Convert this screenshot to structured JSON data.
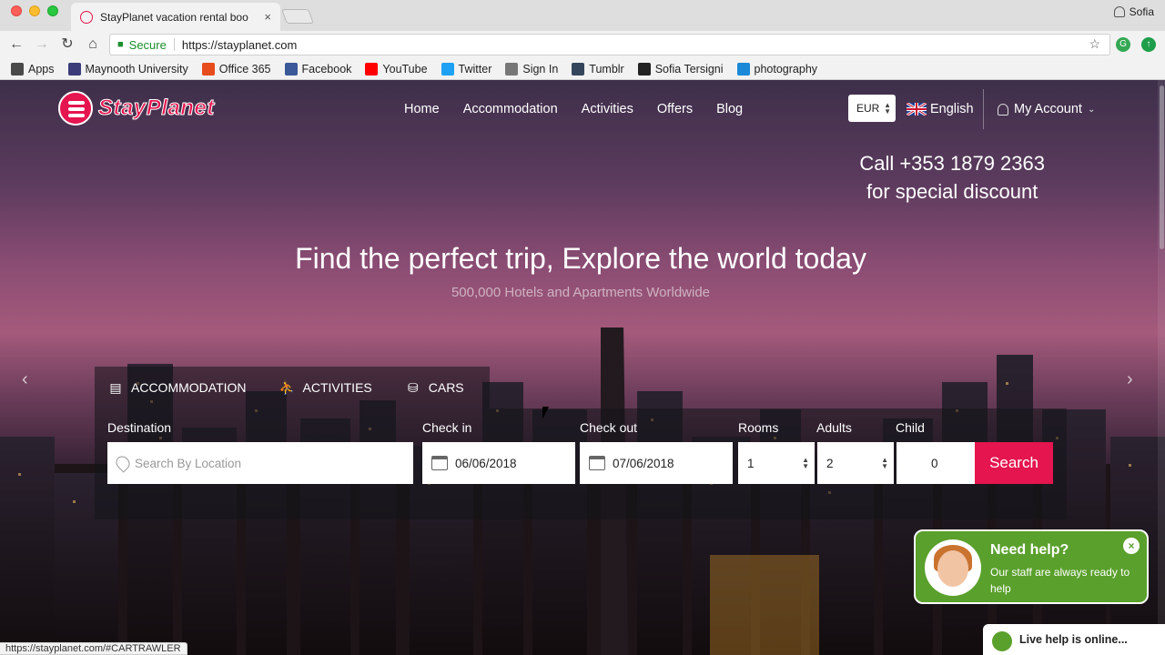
{
  "browser": {
    "tab_title": "StayPlanet vacation rental boo",
    "tab_close": "×",
    "profile_name": "Sofia",
    "url_secure_label": "Secure",
    "url": "https://stayplanet.com",
    "bookmarks": [
      {
        "label": "Apps",
        "icon": "apps-grid-icon",
        "color": "#4a4a4a"
      },
      {
        "label": "Maynooth University",
        "icon": "university-icon",
        "color": "#3b3b7a"
      },
      {
        "label": "Office 365",
        "icon": "office-icon",
        "color": "#e74c1c"
      },
      {
        "label": "Facebook",
        "icon": "facebook-icon",
        "color": "#3b5998"
      },
      {
        "label": "YouTube",
        "icon": "youtube-icon",
        "color": "#ff0000"
      },
      {
        "label": "Twitter",
        "icon": "twitter-icon",
        "color": "#1da1f2"
      },
      {
        "label": "Sign In",
        "icon": "page-icon",
        "color": "#777777"
      },
      {
        "label": "Tumblr",
        "icon": "tumblr-icon",
        "color": "#35465c"
      },
      {
        "label": "Sofia Tersigni",
        "icon": "photo-icon",
        "color": "#222222"
      },
      {
        "label": "photography",
        "icon": "photography-icon",
        "color": "#1a88d6"
      }
    ],
    "status_url": "https://stayplanet.com/#CARTRAWLER"
  },
  "site": {
    "brand": "StayPlanet",
    "brand_color": "#e5154f",
    "nav": [
      "Home",
      "Accommodation",
      "Activities",
      "Offers",
      "Blog"
    ],
    "currency": "EUR",
    "language": "English",
    "account": "My Account",
    "callout_line1": "Call +353 1879 2363",
    "callout_line2": "for special discount",
    "headline": "Find the perfect trip, Explore the world today",
    "subheadline": "500,000 Hotels and Apartments Worldwide"
  },
  "search": {
    "tabs": [
      {
        "label": "ACCOMMODATION",
        "icon": "hotel-icon"
      },
      {
        "label": "ACTIVITIES",
        "icon": "hiking-icon"
      },
      {
        "label": "CARS",
        "icon": "car-icon"
      }
    ],
    "destination_label": "Destination",
    "destination_placeholder": "Search By Location",
    "checkin_label": "Check in",
    "checkin_value": "06/06/2018",
    "checkout_label": "Check out",
    "checkout_value": "07/06/2018",
    "rooms_label": "Rooms",
    "rooms_value": "1",
    "adults_label": "Adults",
    "adults_value": "2",
    "child_label": "Child",
    "child_value": "0",
    "button": "Search"
  },
  "help": {
    "title": "Need help?",
    "text": "Our staff are always ready to help",
    "close": "×",
    "live_label": "Live help is online..."
  }
}
